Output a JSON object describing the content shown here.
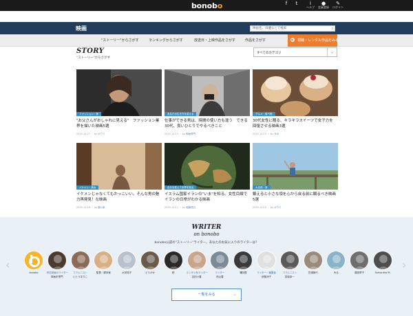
{
  "header": {
    "logo_main": "bonob",
    "logo_accent": "o",
    "buttons": [
      {
        "icon": "facebook-icon",
        "glyph": "f",
        "label": ""
      },
      {
        "icon": "twitter-icon",
        "glyph": "t",
        "label": ""
      },
      {
        "icon": "help-icon",
        "glyph": "i",
        "label": "ヘルプ"
      },
      {
        "icon": "user-icon",
        "glyph": "●",
        "label": "会員登録"
      },
      {
        "icon": "login-icon",
        "glyph": "✎",
        "label": "ログイン"
      }
    ]
  },
  "section": {
    "title": "映画",
    "search_placeholder": "映画名、俳優などで検索",
    "search_icon": "search-icon"
  },
  "tabs": {
    "story": "\"ストーリー\"からさがす",
    "ranking": "ランキングからさがす",
    "schedule": "放送日・上映作品をさがす",
    "works": "作品をさがす",
    "orange": "視聴・レンタル作品をみる"
  },
  "story": {
    "title": "STORY",
    "subtitle": "\"ストーリー\"からさがす",
    "category_select": "すべてのカテゴリ",
    "cards": [
      {
        "category": "ファッション・美",
        "title": "\"お父さんがおしゃれに見える\"　ファッション業界を描いた映画5選",
        "date": "2015.12.27",
        "author": "ボウミ"
      },
      {
        "category": "あなたの生き方を変える",
        "title": "仕事ができる男は、時間の使い方も違う　できる30代、良いひとりでやるべきこと",
        "date": "2015.12.13",
        "author": "映画専門"
      },
      {
        "category": "グルメ・食べ物",
        "title": "30代女性に贈る、キラキラスイーツで女子力を回復させる映画3選",
        "date": "2015.12.15",
        "author": "タボ"
      },
      {
        "category": "イケメン・美女",
        "title": "イケメンじゃなくてもかっこいい。そんな男の魅力再発見！な映画",
        "date": "2015.12.16",
        "author": "鶴川幸"
      },
      {
        "category": "自分を変えて世界を知る",
        "title": "イスラム国家イランの\"いま\"を知る。女性目線でイランの日常がわかる映画",
        "date": "2015.12.11",
        "author": "稲葉悠日"
      },
      {
        "category": "大自然・旅",
        "title": "鍛えると小さな頃を心から戻る前に観るべき映画5選",
        "date": "2015.12.15",
        "author": "ボウミ"
      }
    ]
  },
  "writers": {
    "title": "WRITER",
    "subtitle": "on bonobo",
    "description": "bonobo公認の\"ストーリー\"ライター。あなたのお気に入りのライターは？",
    "all_button": "一覧をみる",
    "people": [
      {
        "name": "bonobo",
        "role": ""
      },
      {
        "name": "映画史専門",
        "role": "有名映画のライター"
      },
      {
        "name": "いとうまりこ",
        "role": "コラムニスト"
      },
      {
        "name": "監督・脚本家",
        "role": ""
      },
      {
        "name": "大河祐子",
        "role": ""
      },
      {
        "name": "どうかか",
        "role": ""
      },
      {
        "name": "稔",
        "role": ""
      },
      {
        "name": "吉田小春",
        "role": "エンタメ系ライター"
      },
      {
        "name": "西山春",
        "role": "ライター"
      },
      {
        "name": "蒲田透",
        "role": ""
      },
      {
        "name": "伊藤涼子",
        "role": "ライター・編集者"
      },
      {
        "name": "芙保幸一",
        "role": "コラムニスト"
      },
      {
        "name": "芝浦美代",
        "role": ""
      },
      {
        "name": "みる",
        "role": ""
      },
      {
        "name": "藤田章子",
        "role": ""
      },
      {
        "name": "Samantha M.",
        "role": ""
      }
    ]
  },
  "colors": {
    "header": "#1a1a1a",
    "section_bar": "#213d5b",
    "accent_orange": "#ee7d2d",
    "category_blue": "#3b8ec2",
    "writer_band": "#e9f0f6"
  }
}
